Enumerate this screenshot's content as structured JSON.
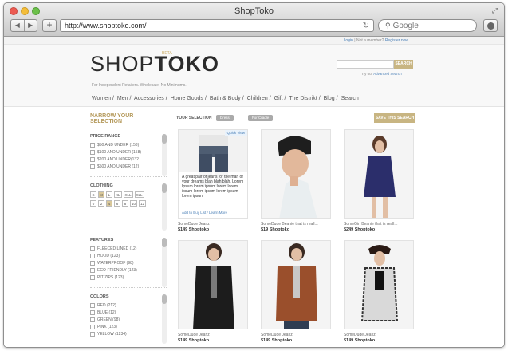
{
  "browser": {
    "title": "ShopToko",
    "url": "http://www.shoptoko.com/",
    "search_placeholder": "Google",
    "back_glyph": "◀",
    "forward_glyph": "▶",
    "add_glyph": "+",
    "reload_glyph": "↻"
  },
  "topbar": {
    "login": "Login",
    "separator": "|",
    "not_member": "Not a member?",
    "register": "Register now"
  },
  "header": {
    "logo_a": "SHOP",
    "logo_b": "TOKO",
    "beta": "BETA",
    "tagline": "For Independent Retailers. Wholesale. No Minimums.",
    "search_button": "SEARCH",
    "advanced_prefix": "Try our",
    "advanced_link": "Advanced Search"
  },
  "nav": [
    "Women",
    "Men",
    "Accessories",
    "Home Goods",
    "Bath & Body",
    "Children",
    "Gift",
    "The Distrikt",
    "Blog",
    "Search"
  ],
  "sidebar": {
    "title": "NARROW YOUR SELECTION",
    "price": {
      "title": "PRICE RANGE",
      "options": [
        "$50 AND UNDER (153)",
        "$100 AND UNDER (158)",
        "$200 AND UNDER(132",
        "$500 AND UNDER (12)"
      ]
    },
    "clothing": {
      "title": "CLOTHING",
      "sizes_row1": [
        "S",
        "M",
        "L",
        "XL",
        "XLL",
        "XLL"
      ],
      "sizes_row2": [
        "0",
        "2",
        "4",
        "6",
        "8",
        "10",
        "12"
      ]
    },
    "features": {
      "title": "FEATURES",
      "options": [
        "FLEECED LINED (12)",
        "HOOD (123)",
        "WATERPROOF (98)",
        "ECO-FRIENDLY (123)",
        "PIT ZIPS (123)"
      ]
    },
    "colors": {
      "title": "COLORS",
      "options": [
        "RED (212)",
        "BLUE (12)",
        "GREEN (98)",
        "PINK (123)",
        "YELLOW (1234)"
      ]
    }
  },
  "main": {
    "selection_label": "YOUR SELECTION",
    "chips": [
      "Dress",
      "For Cradle"
    ],
    "save_button": "SAVE THIS SEARCH",
    "quick_view": "Quick View",
    "hover_text": "A great pair of jeans for the man of your dreams blah blah blah. Lorem Ipsum lorem ipsum lorem lorem ipsum lorem ipsum lorem ipsum lorem ipsum",
    "hover_links": "Add to Buy List / Learn More",
    "products": [
      {
        "name": "SomeDude Jeanz",
        "price": "$149 Shoptoko"
      },
      {
        "name": "SomeDude Beanie that is reall...",
        "price": "$19 Shoptoko"
      },
      {
        "name": "SomeGirl Beanie that is reall...",
        "price": "$249 Shoptoko"
      },
      {
        "name": "SomeDude Jeanz",
        "price": "$149 Shoptoko"
      },
      {
        "name": "SomeDude Jeanz",
        "price": "$149 Shoptoko"
      },
      {
        "name": "SomeDude Jeanz",
        "price": "$149 Shoptoko"
      }
    ]
  }
}
